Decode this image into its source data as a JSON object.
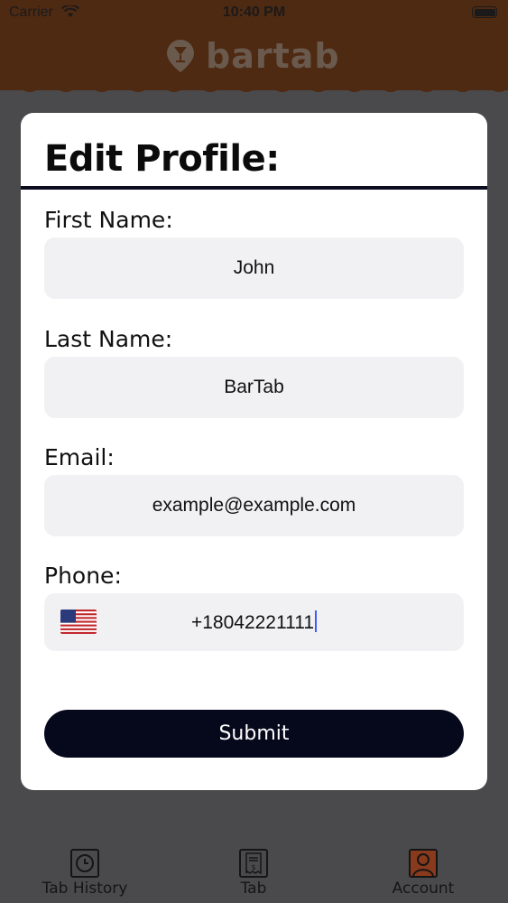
{
  "status_bar": {
    "carrier": "Carrier",
    "time": "10:40 PM"
  },
  "header": {
    "logo_text": "bartab",
    "logo_icon": "glass-pin-icon"
  },
  "modal": {
    "title": "Edit Profile:",
    "fields": {
      "first_name": {
        "label": "First Name:",
        "value": "John"
      },
      "last_name": {
        "label": "Last Name:",
        "value": "BarTab"
      },
      "email": {
        "label": "Email:",
        "value": "example@example.com"
      },
      "phone": {
        "label": "Phone:",
        "value": "+18042221111",
        "country_flag": "us-flag-icon"
      }
    },
    "submit_label": "Submit"
  },
  "tabbar": {
    "items": [
      {
        "label": "Tab History",
        "icon": "clock-history-icon"
      },
      {
        "label": "Tab",
        "icon": "receipt-icon"
      },
      {
        "label": "Account",
        "icon": "account-icon",
        "active": true
      }
    ]
  },
  "colors": {
    "header_bg": "#4f2a12",
    "overlay": "#4a4a4c",
    "field_bg": "#f1f1f4",
    "button_bg": "#06081c",
    "account_accent": "#b5532a"
  }
}
